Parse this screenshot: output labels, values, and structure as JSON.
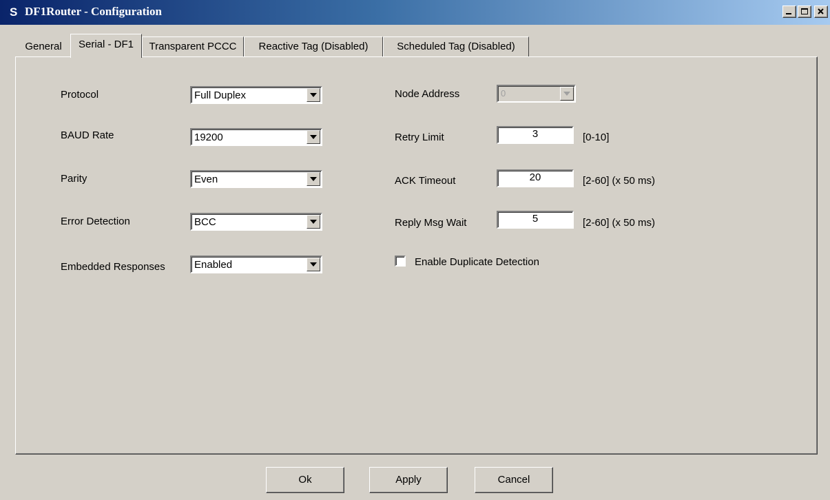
{
  "window": {
    "title": "DF1Router - Configuration",
    "app_icon": "S"
  },
  "tabs": [
    {
      "label": "General",
      "active": false
    },
    {
      "label": "Serial - DF1",
      "active": true
    },
    {
      "label": "Transparent PCCC",
      "active": false
    },
    {
      "label": "Reactive Tag (Disabled)",
      "active": false
    },
    {
      "label": "Scheduled Tag (Disabled)",
      "active": false
    }
  ],
  "left_fields": {
    "protocol": {
      "label": "Protocol",
      "value": "Full Duplex"
    },
    "baud_rate": {
      "label": "BAUD Rate",
      "value": "19200"
    },
    "parity": {
      "label": "Parity",
      "value": "Even"
    },
    "error_detection": {
      "label": "Error Detection",
      "value": "BCC"
    },
    "embedded_responses": {
      "label": "Embedded Responses",
      "value": "Enabled"
    }
  },
  "right_fields": {
    "node_address": {
      "label": "Node Address",
      "value": "0",
      "disabled": true
    },
    "retry_limit": {
      "label": "Retry Limit",
      "value": "3",
      "range": "[0-10]"
    },
    "ack_timeout": {
      "label": "ACK Timeout",
      "value": "20",
      "range": "[2-60] (x 50 ms)"
    },
    "reply_msg_wait": {
      "label": "Reply Msg Wait",
      "value": "5",
      "range": "[2-60] (x 50 ms)"
    }
  },
  "duplicate_detection": {
    "label": "Enable Duplicate Detection",
    "checked": false
  },
  "buttons": {
    "ok": "Ok",
    "apply": "Apply",
    "cancel": "Cancel"
  },
  "colors": {
    "face": "#d4d0c8",
    "titlebar_start": "#0a246a",
    "titlebar_end": "#a6caf0"
  }
}
